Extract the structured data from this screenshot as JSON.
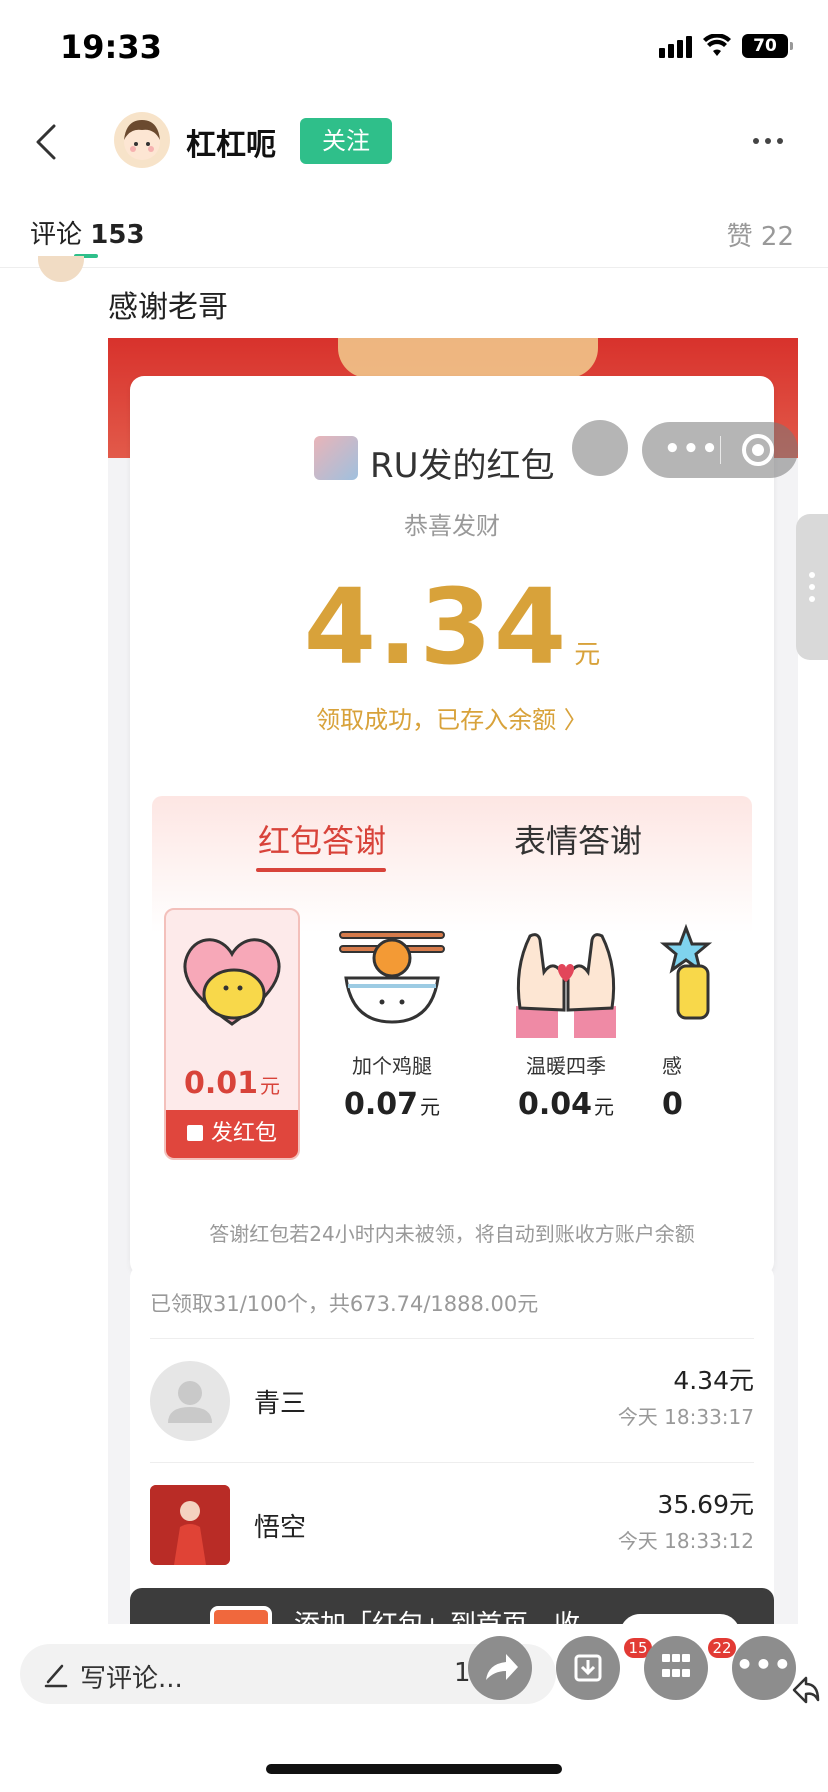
{
  "status_bar": {
    "time": "19:33",
    "battery": "70"
  },
  "header": {
    "username": "杠杠呃",
    "follow_label": "关注"
  },
  "comment_tabs": {
    "comments_label": "评论",
    "comments_count": "153",
    "likes_label": "赞",
    "likes_count": "22"
  },
  "comment": {
    "text": "感谢老哥"
  },
  "screenshot": {
    "red_packet": {
      "title": "RU发的红包",
      "subtitle": "恭喜发财",
      "amount": "4.34",
      "unit": "元",
      "received_text": "领取成功，已存入余额 〉"
    },
    "thanks_tabs": [
      "红包答谢",
      "表情答谢"
    ],
    "gifts": [
      {
        "name": "",
        "price": "0.01",
        "unit": "元",
        "action": "发红包"
      },
      {
        "name": "加个鸡腿",
        "price": "0.07",
        "unit": "元"
      },
      {
        "name": "温暖四季",
        "price": "0.04",
        "unit": "元"
      },
      {
        "name": "感",
        "price": "0",
        "unit": ""
      }
    ],
    "note": "答谢红包若24小时内未被领，将自动到账收方账户余额",
    "stats": "已领取31/100个，共673.74/1888.00元",
    "records": [
      {
        "name": "青三",
        "amount": "4.34元",
        "time": "今天 18:33:17"
      },
      {
        "name": "悟空",
        "amount": "35.69元",
        "time": "今天 18:33:12"
      }
    ],
    "toast_text": "添加「红包」到首页，收"
  },
  "bottom_bar": {
    "comment_placeholder": "写评论...",
    "count_label": "16",
    "badge_1": "15",
    "badge_2": "22"
  },
  "colors": {
    "accent_green": "#2fbf8a",
    "gold": "#d8a23a",
    "red": "#e0463d"
  }
}
